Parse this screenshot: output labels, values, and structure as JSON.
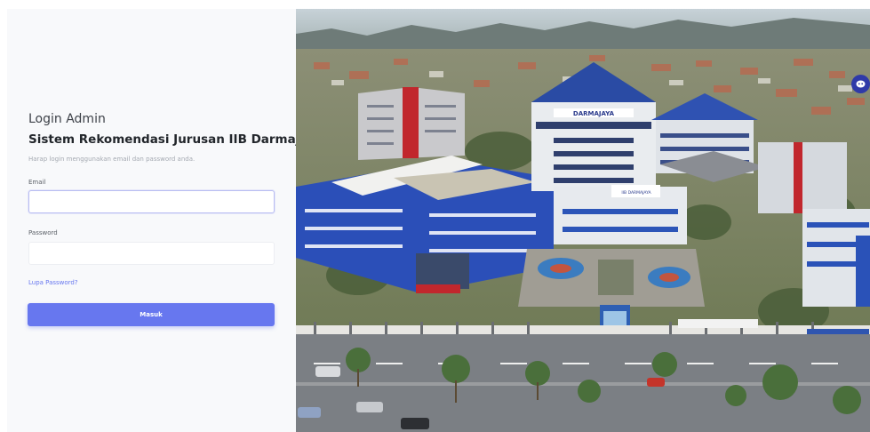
{
  "login": {
    "heading": "Login Admin",
    "system_name": "Sistem Rekomendasi Jurusan IIB Darmajaya",
    "hint": "Harap login menggunakan email dan password anda.",
    "email_label": "Email",
    "email_value": "",
    "password_label": "Password",
    "password_value": "",
    "forgot_link": "Lupa Password?",
    "submit_label": "Masuk"
  },
  "campus_photo": {
    "sign_text": "DARMAJAYA",
    "small_sign_text": "IIB DARMAJAYA"
  },
  "colors": {
    "accent": "#6777ef",
    "panel_bg": "#f8f9fb",
    "chat_bubble": "#2f3aa8"
  },
  "icons": {
    "chat": "chat-bubble-icon"
  }
}
